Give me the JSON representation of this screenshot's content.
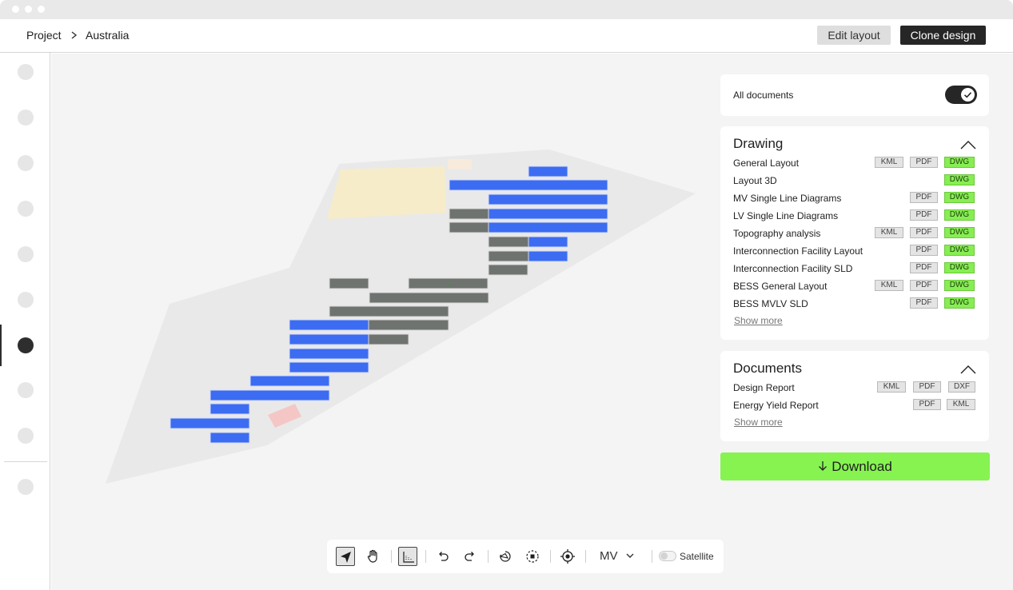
{
  "header": {
    "breadcrumb": [
      "Project",
      "Australia"
    ],
    "edit_layout_label": "Edit layout",
    "clone_design_label": "Clone design"
  },
  "sidebar": {
    "item_count": 10,
    "active_index": 6
  },
  "all_documents": {
    "label": "All documents",
    "enabled": true
  },
  "drawing": {
    "title": "Drawing",
    "items": [
      {
        "name": "General Layout",
        "formats": [
          "KML",
          "PDF",
          "DWG"
        ]
      },
      {
        "name": "Layout 3D",
        "formats": [
          "DWG"
        ]
      },
      {
        "name": "MV Single Line Diagrams",
        "formats": [
          "PDF",
          "DWG"
        ]
      },
      {
        "name": "LV Single Line Diagrams",
        "formats": [
          "PDF",
          "DWG"
        ]
      },
      {
        "name": "Topography analysis",
        "formats": [
          "KML",
          "PDF",
          "DWG"
        ]
      },
      {
        "name": "Interconnection Facility Layout",
        "formats": [
          "PDF",
          "DWG"
        ]
      },
      {
        "name": "Interconnection Facility SLD",
        "formats": [
          "PDF",
          "DWG"
        ]
      },
      {
        "name": "BESS General Layout",
        "formats": [
          "KML",
          "PDF",
          "DWG"
        ]
      },
      {
        "name": "BESS MVLV SLD",
        "formats": [
          "PDF",
          "DWG"
        ]
      }
    ],
    "show_more_label": "Show more"
  },
  "documents": {
    "title": "Documents",
    "items": [
      {
        "name": "Design Report",
        "formats": [
          "KML",
          "PDF",
          "DXF"
        ]
      },
      {
        "name": "Energy Yield Report",
        "formats": [
          "PDF",
          "KML"
        ]
      }
    ],
    "show_more_label": "Show more"
  },
  "download_label": "Download",
  "toolbar": {
    "tools": [
      "select-icon",
      "hand-icon",
      "measure-icon",
      "undo-icon",
      "redo-icon",
      "rotate-icon",
      "rotate-dashed-icon",
      "target-icon"
    ],
    "selected_tool": "measure-icon",
    "layer_label": "MV",
    "satellite_label": "Satellite",
    "satellite_enabled": false
  },
  "colors": {
    "accent_green": "#86f351",
    "dark": "#262626",
    "panel_blue": "#3b6cf2",
    "panel_gray": "#6f736f"
  }
}
